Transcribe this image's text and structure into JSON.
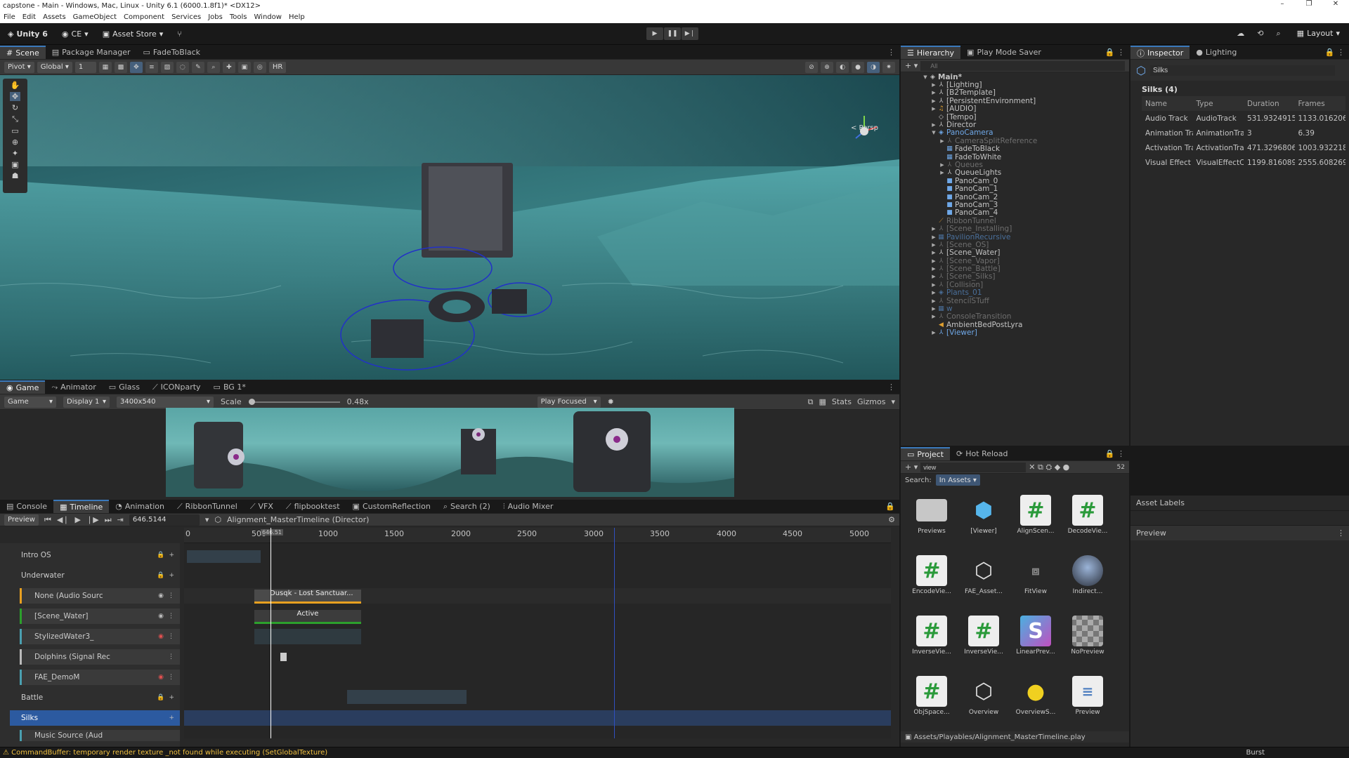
{
  "window": {
    "title": "capstone - Main - Windows, Mac, Linux - Unity 6.1 (6000.1.8f1)* <DX12>",
    "controls": [
      "–",
      "❐",
      "✕"
    ]
  },
  "menu": [
    "File",
    "Edit",
    "Assets",
    "GameObject",
    "Component",
    "Services",
    "Jobs",
    "Tools",
    "Window",
    "Help"
  ],
  "toolbar": {
    "unity": "Unity 6",
    "account": "CE",
    "asset_store": "Asset Store",
    "layout": "Layout"
  },
  "scene": {
    "tabs": [
      "Scene",
      "Package Manager",
      "FadeToBlack"
    ],
    "pivot": "Pivot",
    "global": "Global",
    "grid_val": "1",
    "hr": "HR",
    "persp": "< Persp"
  },
  "game": {
    "tabs": [
      "Game",
      "Animator",
      "Glass",
      "ICONparty",
      "BG 1*"
    ],
    "display_mode": "Game",
    "display": "Display 1",
    "resolution": "3400x540",
    "scale_label": "Scale",
    "scale_val": "0.48x",
    "play_focused": "Play Focused",
    "stats": "Stats",
    "gizmos": "Gizmos"
  },
  "timeline": {
    "tabs": [
      "Console",
      "Timeline",
      "Animation",
      "RibbonTunnel",
      "VFX",
      "flipbooktest",
      "CustomReflection",
      "Search (2)",
      "Audio Mixer"
    ],
    "preview": "Preview",
    "time": "646.5144",
    "asset": "Alignment_MasterTimeline (Director)",
    "playhead_label": "646.51",
    "ruler": [
      "0",
      "500",
      "1000",
      "1500",
      "2000",
      "2500",
      "3000",
      "3500",
      "4000",
      "4500",
      "5000"
    ],
    "groups": [
      "Intro OS",
      "Underwater",
      "Battle",
      "Silks"
    ],
    "tracks": [
      "None (Audio Sourc",
      "[Scene_Water]",
      "StylizedWater3_",
      "Dolphins (Signal Rec",
      "FAE_DemoM",
      "Music Source (Aud"
    ],
    "clips": {
      "audio": "Dusqk - Lost Sanctuar...",
      "active": "Active"
    }
  },
  "hierarchy": {
    "tabs": [
      "Hierarchy",
      "Play Mode Saver"
    ],
    "search_placeholder": "All",
    "items": [
      {
        "label": "Main*",
        "depth": 0
      },
      {
        "label": "[Lighting]",
        "depth": 1
      },
      {
        "label": "[B2Template]",
        "depth": 1
      },
      {
        "label": "[PersistentEnvironment]",
        "depth": 1
      },
      {
        "label": "[AUDIO]",
        "depth": 1
      },
      {
        "label": "[Tempo]",
        "depth": 1
      },
      {
        "label": "Director",
        "depth": 1
      },
      {
        "label": "PanoCamera",
        "depth": 1
      },
      {
        "label": "CameraSplitReference",
        "depth": 2
      },
      {
        "label": "FadeToBlack",
        "depth": 2
      },
      {
        "label": "FadeToWhite",
        "depth": 2
      },
      {
        "label": "Queues",
        "depth": 2
      },
      {
        "label": "QueueLights",
        "depth": 2
      },
      {
        "label": "PanoCam_0",
        "depth": 2
      },
      {
        "label": "PanoCam_1",
        "depth": 2
      },
      {
        "label": "PanoCam_2",
        "depth": 2
      },
      {
        "label": "PanoCam_3",
        "depth": 2
      },
      {
        "label": "PanoCam_4",
        "depth": 2
      },
      {
        "label": "RibbonTunnel",
        "depth": 1
      },
      {
        "label": "[Scene_Installing]",
        "depth": 1
      },
      {
        "label": "PavilionRecursive",
        "depth": 1
      },
      {
        "label": "[Scene_OS]",
        "depth": 1
      },
      {
        "label": "[Scene_Water]",
        "depth": 1
      },
      {
        "label": "[Scene_Vapor]",
        "depth": 1
      },
      {
        "label": "[Scene_Battle]",
        "depth": 1
      },
      {
        "label": "[Scene_Silks]",
        "depth": 1
      },
      {
        "label": "[Collision]",
        "depth": 1
      },
      {
        "label": "Plants_01",
        "depth": 1
      },
      {
        "label": "StencilSTuff",
        "depth": 1
      },
      {
        "label": "w",
        "depth": 1
      },
      {
        "label": "ConsoleTransition",
        "depth": 1
      },
      {
        "label": "AmbientBedPostLyra",
        "depth": 1
      },
      {
        "label": "[Viewer]",
        "depth": 1
      }
    ]
  },
  "inspector": {
    "tabs": [
      "Inspector",
      "Lighting"
    ],
    "object_name": "Silks",
    "section": "Silks (4)",
    "columns": [
      "Name",
      "Type",
      "Duration",
      "Frames"
    ],
    "rows": [
      [
        "Audio Track",
        "AudioTrack",
        "531.9324915",
        "1133.0162069"
      ],
      [
        "Animation Tra",
        "AnimationTra",
        "3",
        "6.39"
      ],
      [
        "Activation Tra",
        "ActivationTra",
        "471.3296806",
        "1003.9322189"
      ],
      [
        "Visual Effect",
        "VisualEffectC",
        "1199.816089",
        "2555.608269"
      ]
    ],
    "asset_labels": "Asset Labels",
    "preview": "Preview"
  },
  "project": {
    "tabs": [
      "Project",
      "Hot Reload"
    ],
    "search": "view",
    "count": "52",
    "search_label": "Search:",
    "scope": "In Assets",
    "items": [
      "Previews",
      "[Viewer]",
      "AlignScen...",
      "DecodeVie...",
      "EncodeVie...",
      "FAE_Asset...",
      "FitView",
      "Indirect...",
      "InverseVie...",
      "InverseVie...",
      "LinearPrev...",
      "NoPreview",
      "ObjSpace...",
      "Overview",
      "OverviewS...",
      "Preview"
    ],
    "path": "Assets/Playables/Alignment_MasterTimeline.play"
  },
  "status": {
    "message": "CommandBuffer: temporary render texture _not found while executing (SetGlobalTexture)",
    "burst": "Burst"
  }
}
